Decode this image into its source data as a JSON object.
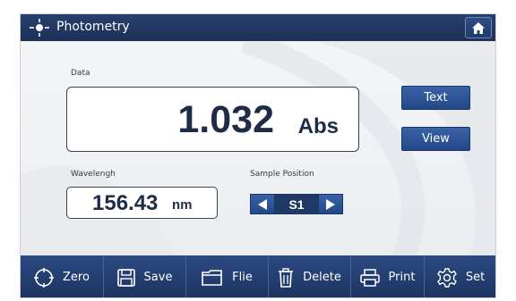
{
  "window": {
    "title": "Photometry",
    "title_icon": "sun-icon",
    "home_icon": "home-icon"
  },
  "data_section": {
    "label": "Data",
    "value": "1.032",
    "unit": "Abs"
  },
  "side_buttons": {
    "text_label": "Text",
    "view_label": "View"
  },
  "wavelength": {
    "label": "Wavelengh",
    "value": "156.43",
    "unit": "nm"
  },
  "sample_position": {
    "label": "Sample Position",
    "value": "S1"
  },
  "toolbar": {
    "items": [
      {
        "label": "Zero",
        "icon": "crosshair-icon"
      },
      {
        "label": "Save",
        "icon": "floppy-disk-icon"
      },
      {
        "label": "Flie",
        "icon": "folder-icon"
      },
      {
        "label": "Delete",
        "icon": "trash-icon"
      },
      {
        "label": "Print",
        "icon": "printer-icon"
      },
      {
        "label": "Set",
        "icon": "gear-icon"
      }
    ]
  },
  "colors": {
    "accent": "#234886",
    "titlebar": "#1d3057",
    "text_dark": "#1f2c45"
  }
}
